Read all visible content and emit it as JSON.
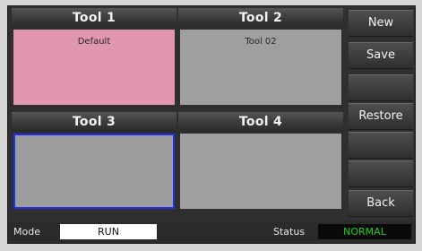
{
  "tools": [
    {
      "header": "Tool 1",
      "name": "Default"
    },
    {
      "header": "Tool 2",
      "name": "Tool 02"
    },
    {
      "header": "Tool 3",
      "name": ""
    },
    {
      "header": "Tool 4",
      "name": ""
    }
  ],
  "buttons": {
    "new": "New",
    "save": "Save",
    "restore": "Restore",
    "back": "Back"
  },
  "statusbar": {
    "mode_label": "Mode",
    "mode_value": "RUN",
    "status_label": "Status",
    "status_value": "NORMAL"
  },
  "colors": {
    "tool1_fill": "#e097ad",
    "selected_border": "#1f2ef0",
    "status_ok": "#22cc22"
  }
}
